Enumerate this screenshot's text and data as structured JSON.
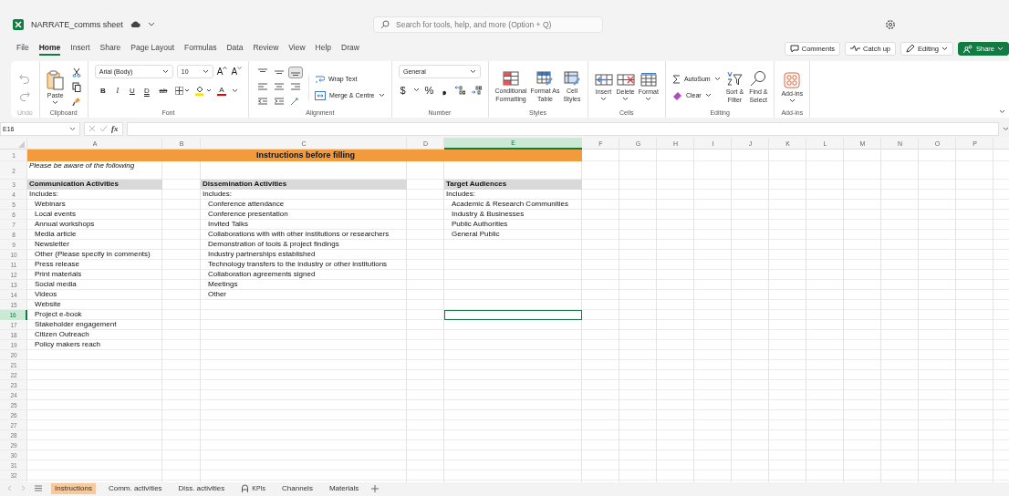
{
  "title_bar": {
    "file_name": "NARRATE_comms sheet",
    "search": {
      "placeholder": "Search for tools, help, and more (Option + Q)"
    }
  },
  "menu": {
    "tabs": [
      {
        "label": "File",
        "selected": false
      },
      {
        "label": "Home",
        "selected": true
      },
      {
        "label": "Insert",
        "selected": false
      },
      {
        "label": "Share",
        "selected": false
      },
      {
        "label": "Page Layout",
        "selected": false
      },
      {
        "label": "Formulas",
        "selected": false
      },
      {
        "label": "Data",
        "selected": false
      },
      {
        "label": "Review",
        "selected": false
      },
      {
        "label": "View",
        "selected": false
      },
      {
        "label": "Help",
        "selected": false
      },
      {
        "label": "Draw",
        "selected": false
      }
    ],
    "actions": [
      {
        "label": "Comments",
        "kind": "comments"
      },
      {
        "label": "Catch up",
        "kind": "catchup"
      },
      {
        "label": "Editing",
        "kind": "editing"
      },
      {
        "label": "Share",
        "kind": "share"
      }
    ]
  },
  "ribbon": {
    "undo": {
      "label": "Undo"
    },
    "clipboard": {
      "label": "Clipboard",
      "paste": "Paste"
    },
    "font": {
      "label": "Font",
      "font_name": "Arial (Body)",
      "font_size": "10",
      "grow": "A",
      "shrink": "A",
      "styles": [
        {
          "glyph": "B",
          "kind": "bold"
        },
        {
          "glyph": "I",
          "kind": "italic"
        },
        {
          "glyph": "U",
          "kind": "underline"
        },
        {
          "glyph": "D",
          "kind": "double"
        },
        {
          "glyph": "ab",
          "kind": "strike"
        }
      ],
      "font_color": "A"
    },
    "alignment": {
      "label": "Alignment",
      "wrap": "Wrap Text",
      "merge": "Merge & Centre",
      "buttons": [
        {
          "kind": "top",
          "selected": false
        },
        {
          "kind": "middle",
          "selected": false
        },
        {
          "kind": "bottom",
          "selected": true
        },
        {
          "kind": "left",
          "selected": false
        },
        {
          "kind": "center",
          "selected": false
        },
        {
          "kind": "right",
          "selected": false
        },
        {
          "kind": "outdent",
          "selected": false
        },
        {
          "kind": "indent",
          "selected": false
        },
        {
          "kind": "orientation",
          "selected": false
        }
      ]
    },
    "number": {
      "label": "Number",
      "format": "General",
      "currency": "$",
      "percent": "%",
      "comma": "❟"
    },
    "styles": {
      "label": "Styles",
      "buttons": [
        {
          "label": "Conditional\nFormatting",
          "kind": "conditional"
        },
        {
          "label": "Format As\nTable",
          "kind": "table"
        },
        {
          "label": "Cell\nStyles",
          "kind": "cellstyles"
        }
      ]
    },
    "cells": {
      "label": "Cells",
      "buttons": [
        {
          "label": "Insert",
          "kind": "insert"
        },
        {
          "label": "Delete",
          "kind": "delete"
        },
        {
          "label": "Format",
          "kind": "format"
        }
      ]
    },
    "editing": {
      "label": "Editing",
      "autosum": "AutoSum",
      "clear": "Clear",
      "sort": "Sort &\nFilter",
      "find": "Find &\nSelect"
    },
    "addins": {
      "label": "Add-ins",
      "button": "Add-ins"
    }
  },
  "formula_bar": {
    "name_box": "E16",
    "function_label": "fx"
  },
  "sheet": {
    "columns": [
      {
        "label": "A",
        "selected": false
      },
      {
        "label": "B",
        "selected": false
      },
      {
        "label": "C",
        "selected": false
      },
      {
        "label": "D",
        "selected": false
      },
      {
        "label": "E",
        "selected": true
      },
      {
        "label": "F",
        "selected": false
      },
      {
        "label": "G",
        "selected": false
      },
      {
        "label": "H",
        "selected": false
      },
      {
        "label": "I",
        "selected": false
      },
      {
        "label": "J",
        "selected": false
      },
      {
        "label": "K",
        "selected": false
      },
      {
        "label": "L",
        "selected": false
      },
      {
        "label": "M",
        "selected": false
      },
      {
        "label": "N",
        "selected": false
      },
      {
        "label": "O",
        "selected": false
      },
      {
        "label": "P",
        "selected": false
      }
    ],
    "rows": [
      {
        "number": "1",
        "selected": false,
        "kind": "title",
        "banner": "Instructions before filling"
      },
      {
        "number": "2",
        "selected": false,
        "kind": "note",
        "a": "Please be aware of the following"
      },
      {
        "number": "3",
        "selected": false,
        "kind": "heading",
        "a": "Communication Activities",
        "c": "Dissemination Activities",
        "e": "Target Audiences"
      },
      {
        "number": "4",
        "selected": false,
        "kind": "label",
        "a": "Includes:",
        "c": "Includes:",
        "e": "Includes:"
      },
      {
        "number": "5",
        "selected": false,
        "kind": "item",
        "a": "Webinars",
        "c": "Conference attendance",
        "e": "Academic & Research Communities"
      },
      {
        "number": "6",
        "selected": false,
        "kind": "item",
        "a": "Local events",
        "c": "Conference presentation",
        "e": "Industry & Businesses"
      },
      {
        "number": "7",
        "selected": false,
        "kind": "item",
        "a": "Annual workshops",
        "c": "Invited Talks",
        "e": "Public Authorities"
      },
      {
        "number": "8",
        "selected": false,
        "kind": "item",
        "a": "Media article",
        "c": "Collaborations with with other institutions or researchers",
        "e": "General Public"
      },
      {
        "number": "9",
        "selected": false,
        "kind": "item",
        "a": "Newsletter",
        "c": "Demonstration of tools & project findings"
      },
      {
        "number": "10",
        "selected": false,
        "kind": "item",
        "a": "Other (Please specify in comments)",
        "c": "Industry partnerships established"
      },
      {
        "number": "11",
        "selected": false,
        "kind": "item",
        "a": "Press release",
        "c": "Technology transfers to the industry or other institutions"
      },
      {
        "number": "12",
        "selected": false,
        "kind": "item",
        "a": "Print materials",
        "c": "Collaboration agreements signed"
      },
      {
        "number": "13",
        "selected": false,
        "kind": "item",
        "a": "Social media",
        "c": "Meetings"
      },
      {
        "number": "14",
        "selected": false,
        "kind": "item",
        "a": "Videos",
        "c": "Other"
      },
      {
        "number": "15",
        "selected": false,
        "kind": "item",
        "a": "Website"
      },
      {
        "number": "16",
        "selected": true,
        "kind": "item",
        "a": "Project e-book"
      },
      {
        "number": "17",
        "selected": false,
        "kind": "item",
        "a": "Stakeholder engagement"
      },
      {
        "number": "18",
        "selected": false,
        "kind": "item",
        "a": "Citizen Outreach"
      },
      {
        "number": "19",
        "selected": false,
        "kind": "item",
        "a": "Policy makers reach"
      },
      {
        "number": "20",
        "selected": false,
        "kind": "item"
      },
      {
        "number": "21",
        "selected": false,
        "kind": "item"
      },
      {
        "number": "22",
        "selected": false,
        "kind": "item"
      },
      {
        "number": "23",
        "selected": false,
        "kind": "item"
      },
      {
        "number": "24",
        "selected": false,
        "kind": "item"
      },
      {
        "number": "25",
        "selected": false,
        "kind": "item"
      },
      {
        "number": "26",
        "selected": false,
        "kind": "item"
      },
      {
        "number": "27",
        "selected": false,
        "kind": "item"
      },
      {
        "number": "28",
        "selected": false,
        "kind": "item"
      },
      {
        "number": "29",
        "selected": false,
        "kind": "item"
      },
      {
        "number": "30",
        "selected": false,
        "kind": "item"
      },
      {
        "number": "31",
        "selected": false,
        "kind": "item"
      },
      {
        "number": "32",
        "selected": false,
        "kind": "item"
      }
    ]
  },
  "sheet_tabs": [
    {
      "label": "Instructions",
      "selected": true,
      "locked": false
    },
    {
      "label": "Comm. activities",
      "selected": false,
      "locked": false
    },
    {
      "label": "Diss. activities",
      "selected": false,
      "locked": false
    },
    {
      "label": "KPIs",
      "selected": false,
      "locked": true
    },
    {
      "label": "Channels",
      "selected": false,
      "locked": false
    },
    {
      "label": "Materials",
      "selected": false,
      "locked": false
    }
  ]
}
